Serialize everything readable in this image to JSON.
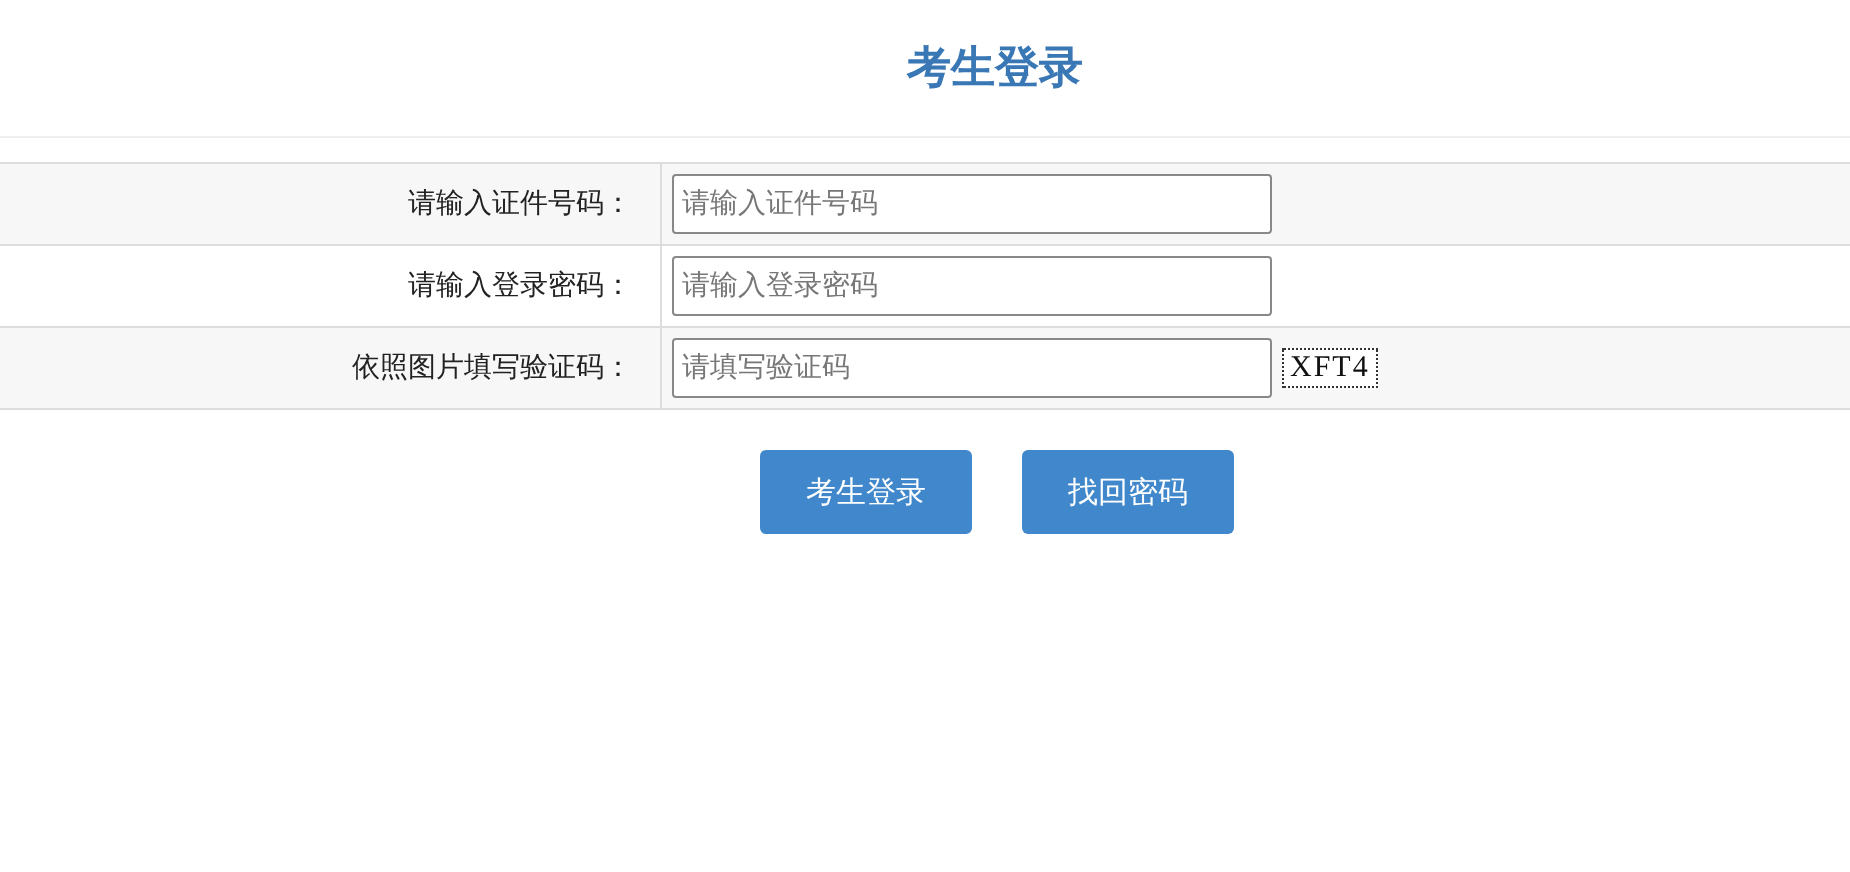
{
  "title": "考生登录",
  "fields": [
    {
      "label": "请输入证件号码：",
      "placeholder": "请输入证件号码",
      "kind": "text"
    },
    {
      "label": "请输入登录密码：",
      "placeholder": "请输入登录密码",
      "kind": "password"
    },
    {
      "label": "依照图片填写验证码：",
      "placeholder": "请填写验证码",
      "kind": "captcha",
      "captcha": "XFT4"
    }
  ],
  "buttons": [
    "考生登录",
    "找回密码"
  ]
}
